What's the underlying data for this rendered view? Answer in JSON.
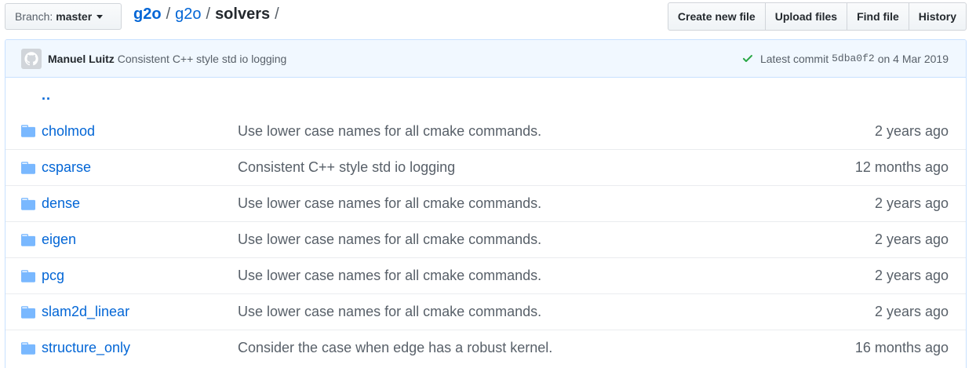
{
  "branch": {
    "label": "Branch:",
    "value": "master"
  },
  "breadcrumb": {
    "owner": "g2o",
    "repo": "g2o",
    "sep": "/",
    "current": "solvers",
    "trailing": "/"
  },
  "toolbar": {
    "create": "Create new file",
    "upload": "Upload files",
    "find": "Find file",
    "history": "History"
  },
  "commit": {
    "author": "Manuel Luitz",
    "message": "Consistent C++ style std io logging",
    "latest_label": "Latest commit",
    "sha": "5dba0f2",
    "on": "on",
    "date": "4 Mar 2019"
  },
  "parent_link": "..",
  "files": [
    {
      "name": "cholmod",
      "message": "Use lower case names for all cmake commands.",
      "age": "2 years ago"
    },
    {
      "name": "csparse",
      "message": "Consistent C++ style std io logging",
      "age": "12 months ago"
    },
    {
      "name": "dense",
      "message": "Use lower case names for all cmake commands.",
      "age": "2 years ago"
    },
    {
      "name": "eigen",
      "message": "Use lower case names for all cmake commands.",
      "age": "2 years ago"
    },
    {
      "name": "pcg",
      "message": "Use lower case names for all cmake commands.",
      "age": "2 years ago"
    },
    {
      "name": "slam2d_linear",
      "message": "Use lower case names for all cmake commands.",
      "age": "2 years ago"
    },
    {
      "name": "structure_only",
      "message": "Consider the case when edge has a robust kernel.",
      "age": "16 months ago"
    }
  ],
  "colors": {
    "link": "#0366d6",
    "muted": "#586069",
    "success": "#28a745",
    "folder": "#79b8ff"
  },
  "icons": {
    "folder": "folder-icon",
    "check": "check-icon",
    "avatar": "avatar-icon",
    "caret": "caret-down-icon"
  }
}
